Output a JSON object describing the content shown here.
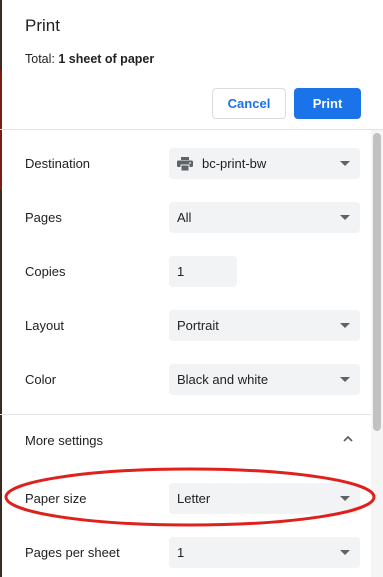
{
  "header": {
    "title": "Print",
    "total_prefix": "Total: ",
    "total_value": "1 sheet of paper",
    "cancel_label": "Cancel",
    "print_label": "Print"
  },
  "settings": {
    "destination": {
      "label": "Destination",
      "value": "bc-print-bw",
      "icon": "printer-icon"
    },
    "pages": {
      "label": "Pages",
      "value": "All"
    },
    "copies": {
      "label": "Copies",
      "value": "1"
    },
    "layout": {
      "label": "Layout",
      "value": "Portrait"
    },
    "color": {
      "label": "Color",
      "value": "Black and white"
    }
  },
  "more_settings": {
    "label": "More settings",
    "expanded": true,
    "paper_size": {
      "label": "Paper size",
      "value": "Letter"
    },
    "pages_per_sheet": {
      "label": "Pages per sheet",
      "value": "1"
    }
  },
  "annotation": {
    "type": "red-ellipse",
    "highlights": "paper_size",
    "color": "#e0201b"
  },
  "colors": {
    "accent": "#1a73e8",
    "field_bg": "#f1f3f4"
  }
}
